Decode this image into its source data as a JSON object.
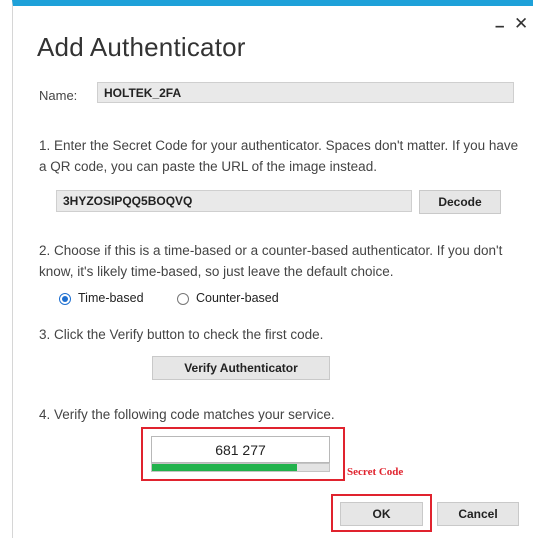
{
  "window": {
    "title": "Add Authenticator",
    "minimize_glyph": "–",
    "close_glyph": "✕",
    "accent_color": "#1ea1d9"
  },
  "name_row": {
    "label": "Name:",
    "value": "HOLTEK_2FA"
  },
  "step1": {
    "text": "1. Enter the Secret Code for your authenticator. Spaces don't matter. If you have a QR code, you can paste the URL of the image instead.",
    "secret_value": "3HYZOSIPQQ5BOQVQ",
    "decode_label": "Decode"
  },
  "step2": {
    "text": "2. Choose if this is a time-based or a counter-based authenticator. If you don't know, it's likely time-based, so just leave the default choice.",
    "options": [
      {
        "label": "Time-based",
        "checked": true
      },
      {
        "label": "Counter-based",
        "checked": false
      }
    ]
  },
  "step3": {
    "text": "3. Click the Verify button to check the first code.",
    "verify_label": "Verify Authenticator"
  },
  "step4": {
    "text": "4. Verify the following code matches your service.",
    "code": "681 277",
    "progress_fraction": 0.82,
    "progress_color": "#22b24c"
  },
  "annotation": {
    "text": "Secret Code",
    "color": "#e0232e"
  },
  "footer": {
    "ok_label": "OK",
    "cancel_label": "Cancel"
  }
}
